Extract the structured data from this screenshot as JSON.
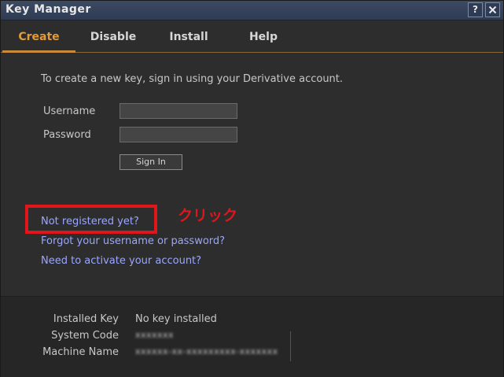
{
  "window": {
    "title": "Key Manager",
    "help_glyph": "?",
    "close_glyph": "x"
  },
  "tabs": [
    {
      "label": "Create",
      "active": true
    },
    {
      "label": "Disable",
      "active": false
    },
    {
      "label": "Install",
      "active": false
    },
    {
      "label": "Help",
      "active": false
    }
  ],
  "create": {
    "intro": "To create a new key, sign in using your Derivative account.",
    "username_label": "Username",
    "username_value": "",
    "password_label": "Password",
    "password_value": "",
    "signin_label": "Sign In",
    "links": {
      "not_registered": "Not registered yet?",
      "forgot": "Forgot your username or password?",
      "activate": "Need to activate your account?"
    }
  },
  "annotation": {
    "text": "クリック",
    "color": "#e0161b"
  },
  "info": {
    "installed_key_label": "Installed Key",
    "installed_key_value": "No key installed",
    "system_code_label": "System Code",
    "system_code_value": "xxxxxxx",
    "machine_name_label": "Machine Name",
    "machine_name_value": "xxxxxx-xx-xxxxxxxxx-xxxxxxx"
  },
  "colors": {
    "accent": "#e39a3b",
    "link": "#9aa6ff",
    "titlebar": "#2f3b52"
  }
}
